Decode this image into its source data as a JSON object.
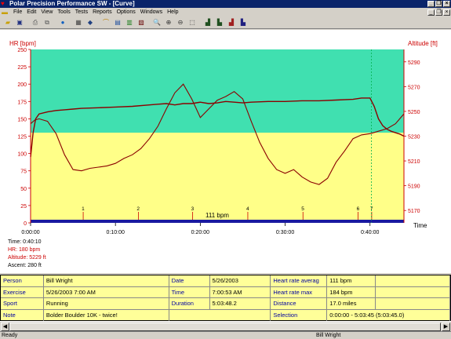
{
  "window": {
    "title": "Polar Precision Performance SW - [Curve]"
  },
  "menu": [
    "File",
    "Edit",
    "View",
    "Tools",
    "Tests",
    "Reports",
    "Options",
    "Windows",
    "Help"
  ],
  "colors": {
    "hr_line": "#8b0000",
    "altitude_line": "#8b0000",
    "hr_zone_fill": "#40e0b0",
    "below_zone_fill": "#ffff88",
    "axis_red": "#cc0000",
    "time_axis_bar": "#1a1aa0",
    "lap_marker": "#cc0000",
    "cursor_line": "#00b050"
  },
  "chart": {
    "left_axis_label": "HR [bpm]",
    "right_axis_label": "Altitude [ft]",
    "x_axis_label": "Time",
    "hr_ticks": [
      "250",
      "225",
      "200",
      "175",
      "150",
      "125",
      "100",
      "75",
      "50",
      "25",
      "0"
    ],
    "alt_ticks": [
      "5290",
      "5270",
      "5250",
      "5230",
      "5210",
      "5190",
      "5170"
    ],
    "time_ticks": [
      "0:00:00",
      "0:10:00",
      "0:20:00",
      "0:30:00",
      "0:40:00"
    ],
    "lap_markers": [
      "1",
      "2",
      "3",
      "4",
      "5",
      "6",
      "7"
    ],
    "cursor_readout": "111 bpm",
    "cursor_time": "Time: 0:40:10",
    "cursor_hr": "HR: 180 bpm",
    "cursor_altitude": "Altitude: 5229 ft",
    "cursor_ascent": "Ascent: 280 ft"
  },
  "chart_data": {
    "type": "line",
    "xlabel": "Time",
    "ylabel": "HR [bpm]",
    "y2label": "Altitude [ft]",
    "xlim_min": [
      0,
      44
    ],
    "ylim": [
      0,
      250
    ],
    "y2lim": [
      5160,
      5300
    ],
    "hr_zone": [
      130,
      250
    ],
    "series": [
      {
        "name": "HR [bpm]",
        "axis": "left",
        "x": [
          0,
          0.3,
          0.6,
          1,
          2,
          3,
          4,
          5,
          6,
          8,
          10,
          12,
          14,
          15,
          16,
          17,
          18,
          19,
          20,
          21,
          22,
          23,
          24,
          25,
          26,
          28,
          30,
          32,
          34,
          36,
          38,
          39,
          40,
          40.5,
          41,
          41.5,
          42,
          42.5,
          43,
          43.5,
          44
        ],
        "values": [
          95,
          130,
          150,
          157,
          160,
          162,
          163,
          164,
          165,
          166,
          167,
          168,
          170,
          171,
          172,
          170,
          172,
          172,
          174,
          172,
          173,
          175,
          174,
          173,
          174,
          175,
          175,
          176,
          176,
          177,
          178,
          180,
          180,
          168,
          150,
          140,
          135,
          132,
          130,
          128,
          125
        ]
      },
      {
        "name": "Altitude [ft]",
        "axis": "right",
        "x": [
          0,
          0.5,
          1,
          2,
          3,
          4,
          5,
          6,
          7,
          8,
          9,
          10,
          11,
          12,
          13,
          14,
          15,
          16,
          17,
          18,
          19,
          20,
          21,
          22,
          23,
          24,
          25,
          26,
          27,
          28,
          29,
          30,
          31,
          32,
          33,
          34,
          35,
          36,
          37,
          38,
          39,
          40,
          40.5,
          41,
          42,
          43,
          44
        ],
        "values": [
          5240,
          5243,
          5244,
          5242,
          5232,
          5215,
          5203,
          5202,
          5204,
          5205,
          5206,
          5208,
          5212,
          5215,
          5220,
          5228,
          5238,
          5252,
          5265,
          5272,
          5260,
          5245,
          5252,
          5259,
          5262,
          5266,
          5260,
          5242,
          5225,
          5212,
          5203,
          5200,
          5203,
          5197,
          5193,
          5191,
          5196,
          5209,
          5218,
          5228,
          5231,
          5232,
          5233,
          5234,
          5236,
          5240,
          5248
        ]
      }
    ],
    "laps": [
      {
        "label": "1",
        "x": 6.2
      },
      {
        "label": "2",
        "x": 12.7
      },
      {
        "label": "3",
        "x": 19.1
      },
      {
        "label": "4",
        "x": 25.6
      },
      {
        "label": "5",
        "x": 32.1
      },
      {
        "label": "6",
        "x": 38.6
      },
      {
        "label": "7",
        "x": 40.2
      }
    ],
    "cursor_x": 40.17
  },
  "info": {
    "rows": [
      [
        {
          "v": "Person",
          "l": true
        },
        {
          "v": "Bill Wright"
        },
        {
          "v": "Date",
          "l": true
        },
        {
          "v": "5/26/2003"
        },
        {
          "v": "Heart rate averag",
          "l": true
        },
        {
          "v": "111 bpm"
        },
        {
          "v": ""
        }
      ],
      [
        {
          "v": "Exercise",
          "l": true
        },
        {
          "v": "5/26/2003 7:00 AM"
        },
        {
          "v": "Time",
          "l": true
        },
        {
          "v": "7:00:53 AM"
        },
        {
          "v": "Heart rate max",
          "l": true
        },
        {
          "v": "184 bpm"
        },
        {
          "v": ""
        }
      ],
      [
        {
          "v": "Sport",
          "l": true
        },
        {
          "v": "Running"
        },
        {
          "v": "Duration",
          "l": true
        },
        {
          "v": "5:03:48.2"
        },
        {
          "v": "Distance",
          "l": true
        },
        {
          "v": "17.0 miles"
        },
        {
          "v": ""
        }
      ],
      [
        {
          "v": "Note",
          "l": true
        },
        {
          "v": "Bolder Boulder 10K - twice!"
        },
        {
          "v": "",
          "span": true
        },
        {
          "v": "",
          "skip": true
        },
        {
          "v": "Selection",
          "l": true
        },
        {
          "v": "0:00:00 - 5:03:45 (5:03:45.0)",
          "wide": true
        },
        {
          "v": "",
          "skip": true
        }
      ]
    ]
  },
  "status": {
    "left": "Ready",
    "right": "Bill Wright"
  }
}
